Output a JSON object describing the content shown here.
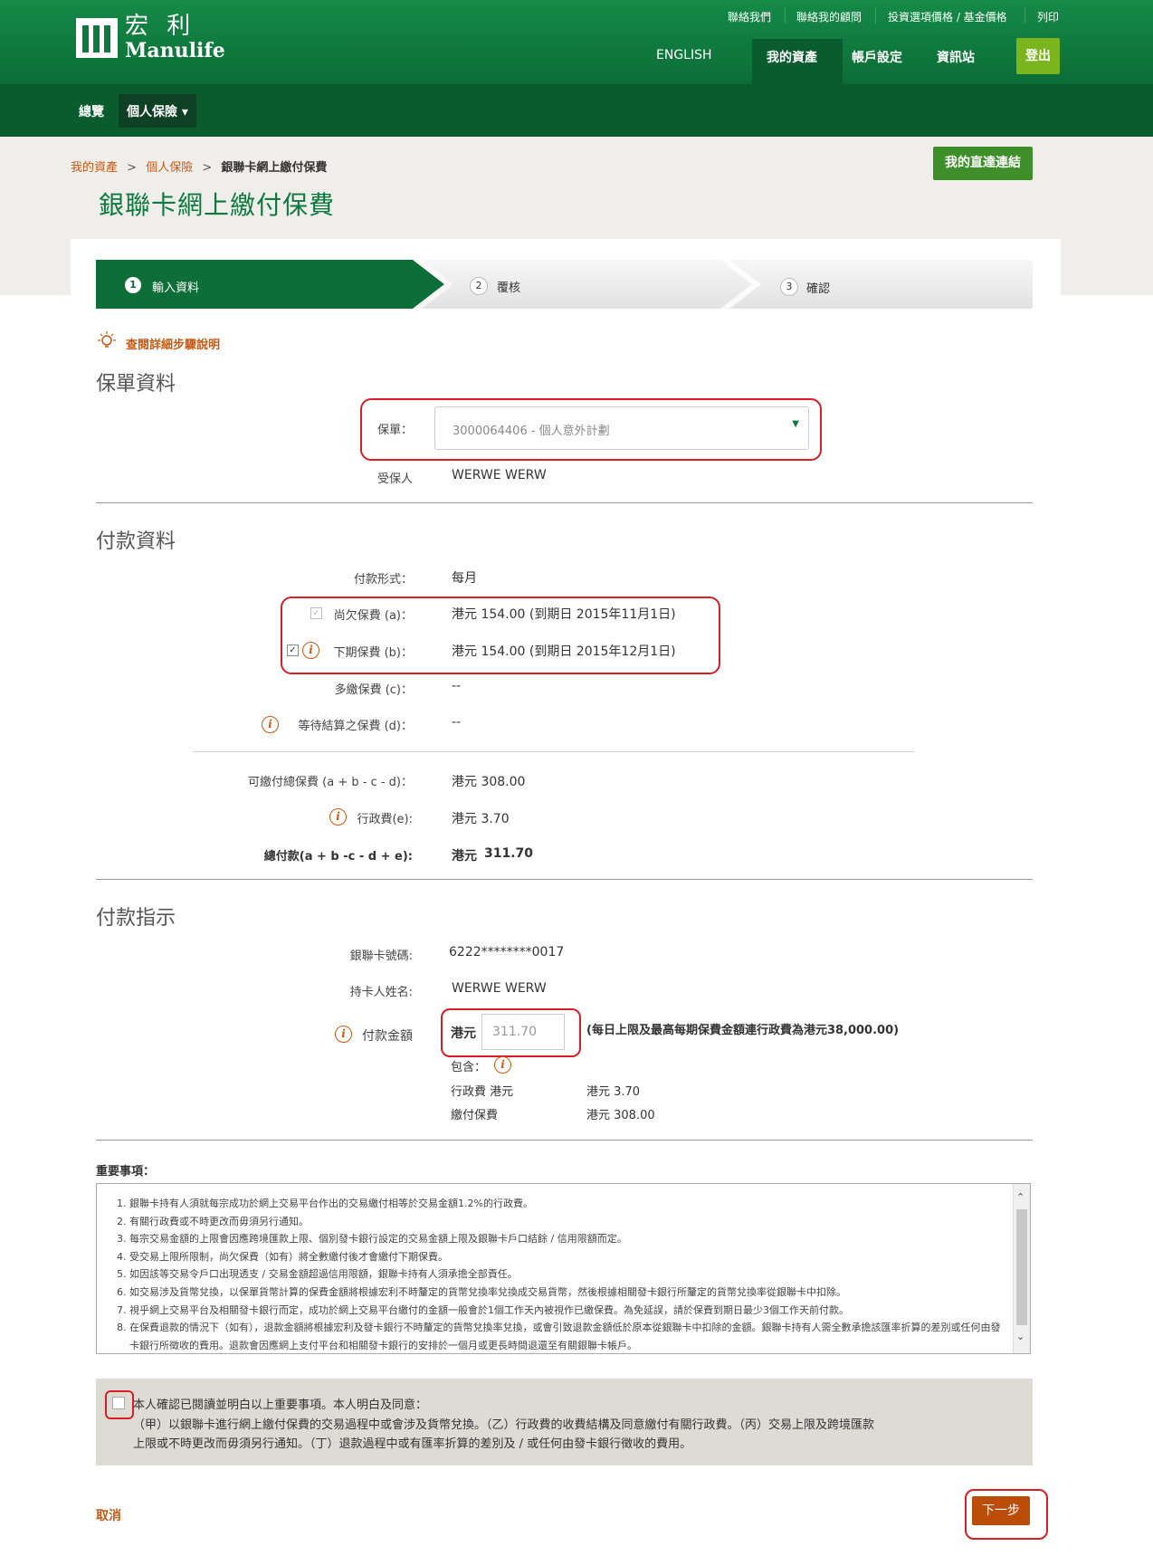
{
  "header": {
    "logo_cn": "宏 利",
    "logo_en": "Manulife",
    "utility_links": [
      "聯絡我們",
      "聯絡我的顧問",
      "投資選項價格 / 基金價格",
      "列印"
    ],
    "language": "ENGLISH",
    "main_nav": [
      "我的資產",
      "帳戶設定",
      "資訊站"
    ],
    "logout": "登出",
    "sub_nav": [
      "總覽",
      "個人保險 ▾"
    ]
  },
  "breadcrumb": [
    "我的資產",
    "個人保險",
    "銀聯卡網上繳付保費"
  ],
  "breadcrumb_sep": ">",
  "page_title": "銀聯卡網上繳付保費",
  "quick_link": "我的直達連結",
  "steps": [
    {
      "num": "1",
      "label": "輸入資料"
    },
    {
      "num": "2",
      "label": "覆核"
    },
    {
      "num": "3",
      "label": "確認"
    }
  ],
  "help_link": "查閱詳細步驟說明",
  "policy_section": {
    "title": "保單資料",
    "policy_label": "保單：",
    "policy_value": "3000064406 - 個人意外計劃",
    "insured_label": "受保人",
    "insured_value": "WERWE WERW"
  },
  "payment_section": {
    "title": "付款資料",
    "freq_label": "付款形式：",
    "freq_value": "每月",
    "overdue_label": "尚欠保費 (a)：",
    "overdue_value": "港元 154.00 (到期日 2015年11月1日)",
    "next_label": "下期保費 (b)：",
    "next_value": "港元 154.00 (到期日 2015年12月1日)",
    "over_label": "多繳保費 (c)：",
    "over_value": "--",
    "pending_label": "等待結算之保費 (d)：",
    "pending_value": "--",
    "total_label": "可繳付總保費 (a + b - c - d)：",
    "total_value": "港元 308.00",
    "fee_label": "行政費(e):",
    "fee_value": "港元 3.70",
    "grand_label": "總付款(a + b -c - d + e):",
    "grand_currency": "港元",
    "grand_value": "311.70"
  },
  "instruction_section": {
    "title": "付款指示",
    "card_label": "銀聯卡號碼:",
    "card_value": "6222********0017",
    "holder_label": "持卡人姓名:",
    "holder_value": "WERWE WERW",
    "amount_label": "付款金額",
    "amount_currency": "港元",
    "amount_value": "311.70",
    "limit_note": "(每日上限及最高每期保費金額連行政費為港元38,000.00)",
    "include_label": "包含：",
    "fee_label": "行政費 港元",
    "fee_value": "港元 3.70",
    "premium_label": "繳付保費",
    "premium_value": "港元 308.00"
  },
  "notes": {
    "title": "重要事項：",
    "items": [
      "銀聯卡持有人須就每宗成功於網上交易平台作出的交易繳付相等於交易金額1.2%的行政費。",
      "有關行政費或不時更改而毋須另行通知。",
      "每宗交易金額的上限會因應跨境匯款上限、個別發卡銀行設定的交易金額上限及銀聯卡戶口結餘 / 信用限額而定。",
      "受交易上限所限制，尚欠保費（如有）將全數繳付後才會繳付下期保費。",
      "如因該等交易令戶口出現透支 / 交易金額超過信用限額，銀聯卡持有人須承擔全部責任。",
      "如交易涉及貨幣兌換，以保單貨幣計算的保費金額將根據宏利不時釐定的貨幣兌換率兌換成交易貨幣，然後根據相關發卡銀行所釐定的貨幣兌換率從銀聯卡中扣除。",
      "視乎網上交易平台及相關發卡銀行而定，成功於網上交易平台繳付的金額一般會於1個工作天內被視作已繳保費。為免延誤，請於保費到期日最少3個工作天前付款。",
      "在保費退款的情況下（如有），退款金額將根據宏利及發卡銀行不時釐定的貨幣兌換率兌換，或會引致退款金額低於原本從銀聯卡中扣除的金額。銀聯卡持有人需全數承擔該匯率折算的差別或任何由發卡銀行所徵收的費用。退款會因應網上支付平台和相關發卡銀行的安排於一個月或更長時間退還至有關銀聯卡帳戶。"
    ]
  },
  "agreement": {
    "line1": "本人確認已閱讀並明白以上重要事項。本人明白及同意：",
    "line2": "（甲）以銀聯卡進行網上繳付保費的交易過程中或會涉及貨幣兌換。（乙）行政費的收費結構及同意繳付有關行政費。（丙）交易上限及跨境匯款",
    "line3": "上限或不時更改而毋須另行通知。（丁）退款過程中或有匯率折算的差別及 / 或任何由發卡銀行徵收的費用。"
  },
  "footer": {
    "cancel": "取消",
    "next": "下一步"
  },
  "colors": {
    "brand_green": "#0c7a3e",
    "accent_orange": "#c65a13",
    "highlight_red": "#d51f26",
    "logout_green": "#7ab51d"
  }
}
